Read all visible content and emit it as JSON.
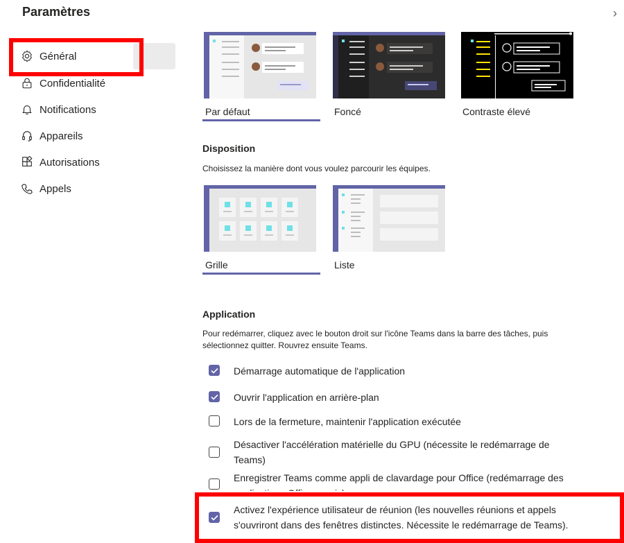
{
  "header": {
    "title": "Paramètres"
  },
  "sidebar": {
    "items": [
      {
        "label": "Général",
        "icon": "gear-icon"
      },
      {
        "label": "Confidentialité",
        "icon": "lock-icon"
      },
      {
        "label": "Notifications",
        "icon": "bell-icon"
      },
      {
        "label": "Appareils",
        "icon": "headset-icon"
      },
      {
        "label": "Autorisations",
        "icon": "apps-icon"
      },
      {
        "label": "Appels",
        "icon": "phone-icon"
      }
    ]
  },
  "theme": {
    "options": [
      {
        "label": "Par défaut",
        "selected": true
      },
      {
        "label": "Foncé",
        "selected": false
      },
      {
        "label": "Contraste élevé",
        "selected": false
      }
    ]
  },
  "layout": {
    "heading": "Disposition",
    "description": "Choisissez la manière dont vous voulez parcourir les équipes.",
    "options": [
      {
        "label": "Grille",
        "selected": true
      },
      {
        "label": "Liste",
        "selected": false
      }
    ]
  },
  "application": {
    "heading": "Application",
    "description_line1": "Pour redémarrer, cliquez avec le bouton droit sur l'icône Teams dans la barre des tâches, puis",
    "description_line2": "sélectionnez quitter. Rouvrez ensuite Teams.",
    "options": [
      {
        "line1": "Démarrage automatique de l'application",
        "line2": "",
        "checked": true
      },
      {
        "line1": "Ouvrir l'application en arrière-plan",
        "line2": "",
        "checked": true
      },
      {
        "line1": "Lors de la fermeture, maintenir l'application exécutée",
        "line2": "",
        "checked": false
      },
      {
        "line1": "Désactiver l'accélération matérielle du GPU (nécessite le redémarrage de",
        "line2": "Teams)",
        "checked": false
      },
      {
        "line1": "Enregistrer Teams comme appli de clavardage pour Office (redémarrage des",
        "line2": "applications Office requis)",
        "checked": false
      },
      {
        "line1": "Activez l'expérience utilisateur de réunion (les nouvelles réunions et appels",
        "line2": "s'ouvriront dans des fenêtres distinctes. Nécessite le redémarrage de Teams).",
        "checked": true
      }
    ]
  },
  "colors": {
    "accent": "#6264a7",
    "highlight": "#ff0000",
    "text": "#252423"
  }
}
